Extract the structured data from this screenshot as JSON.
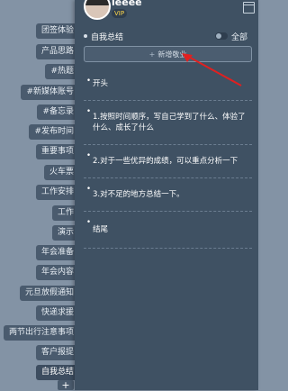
{
  "user": {
    "name": "leeee",
    "vip": "VIP"
  },
  "header": {
    "title": "自我总结",
    "filter_label": "全部"
  },
  "new_button": {
    "label": "新增敬业",
    "plus": "+"
  },
  "notes": [
    "开头",
    "1.按照时间顺序，写自己学到了什么、体验了什么、成长了什么",
    "2.对于一些优异的成绩，可以重点分析一下",
    "3.对不足的地方总结一下。",
    "结尾"
  ],
  "tags": [
    "团签体验",
    "产品思路",
    "#热题",
    "#新媒体账号",
    "#备忘录",
    "#发布时间",
    "重要事项",
    "火车票",
    "工作安排",
    "工作",
    "演示",
    "年会准备",
    "年会内容",
    "元旦放假通知",
    "快递求援",
    "两节出行注意事项",
    "客户报提",
    "自我总结"
  ],
  "add_tag": "+",
  "colors": {
    "panel": "#3f5163",
    "tag": "#4a5b6e",
    "background": "#8393a5",
    "arrow": "#e02020"
  }
}
